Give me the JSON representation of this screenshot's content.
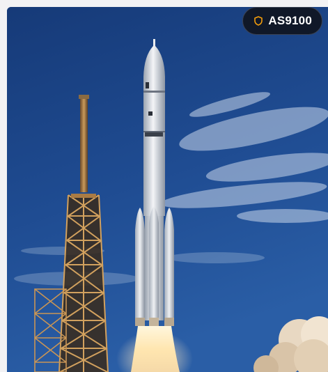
{
  "badge": {
    "label": "AS9100",
    "icon": "shield-icon",
    "icon_color": "#f59e0b"
  },
  "image": {
    "subject": "rocket-launch-photo"
  }
}
